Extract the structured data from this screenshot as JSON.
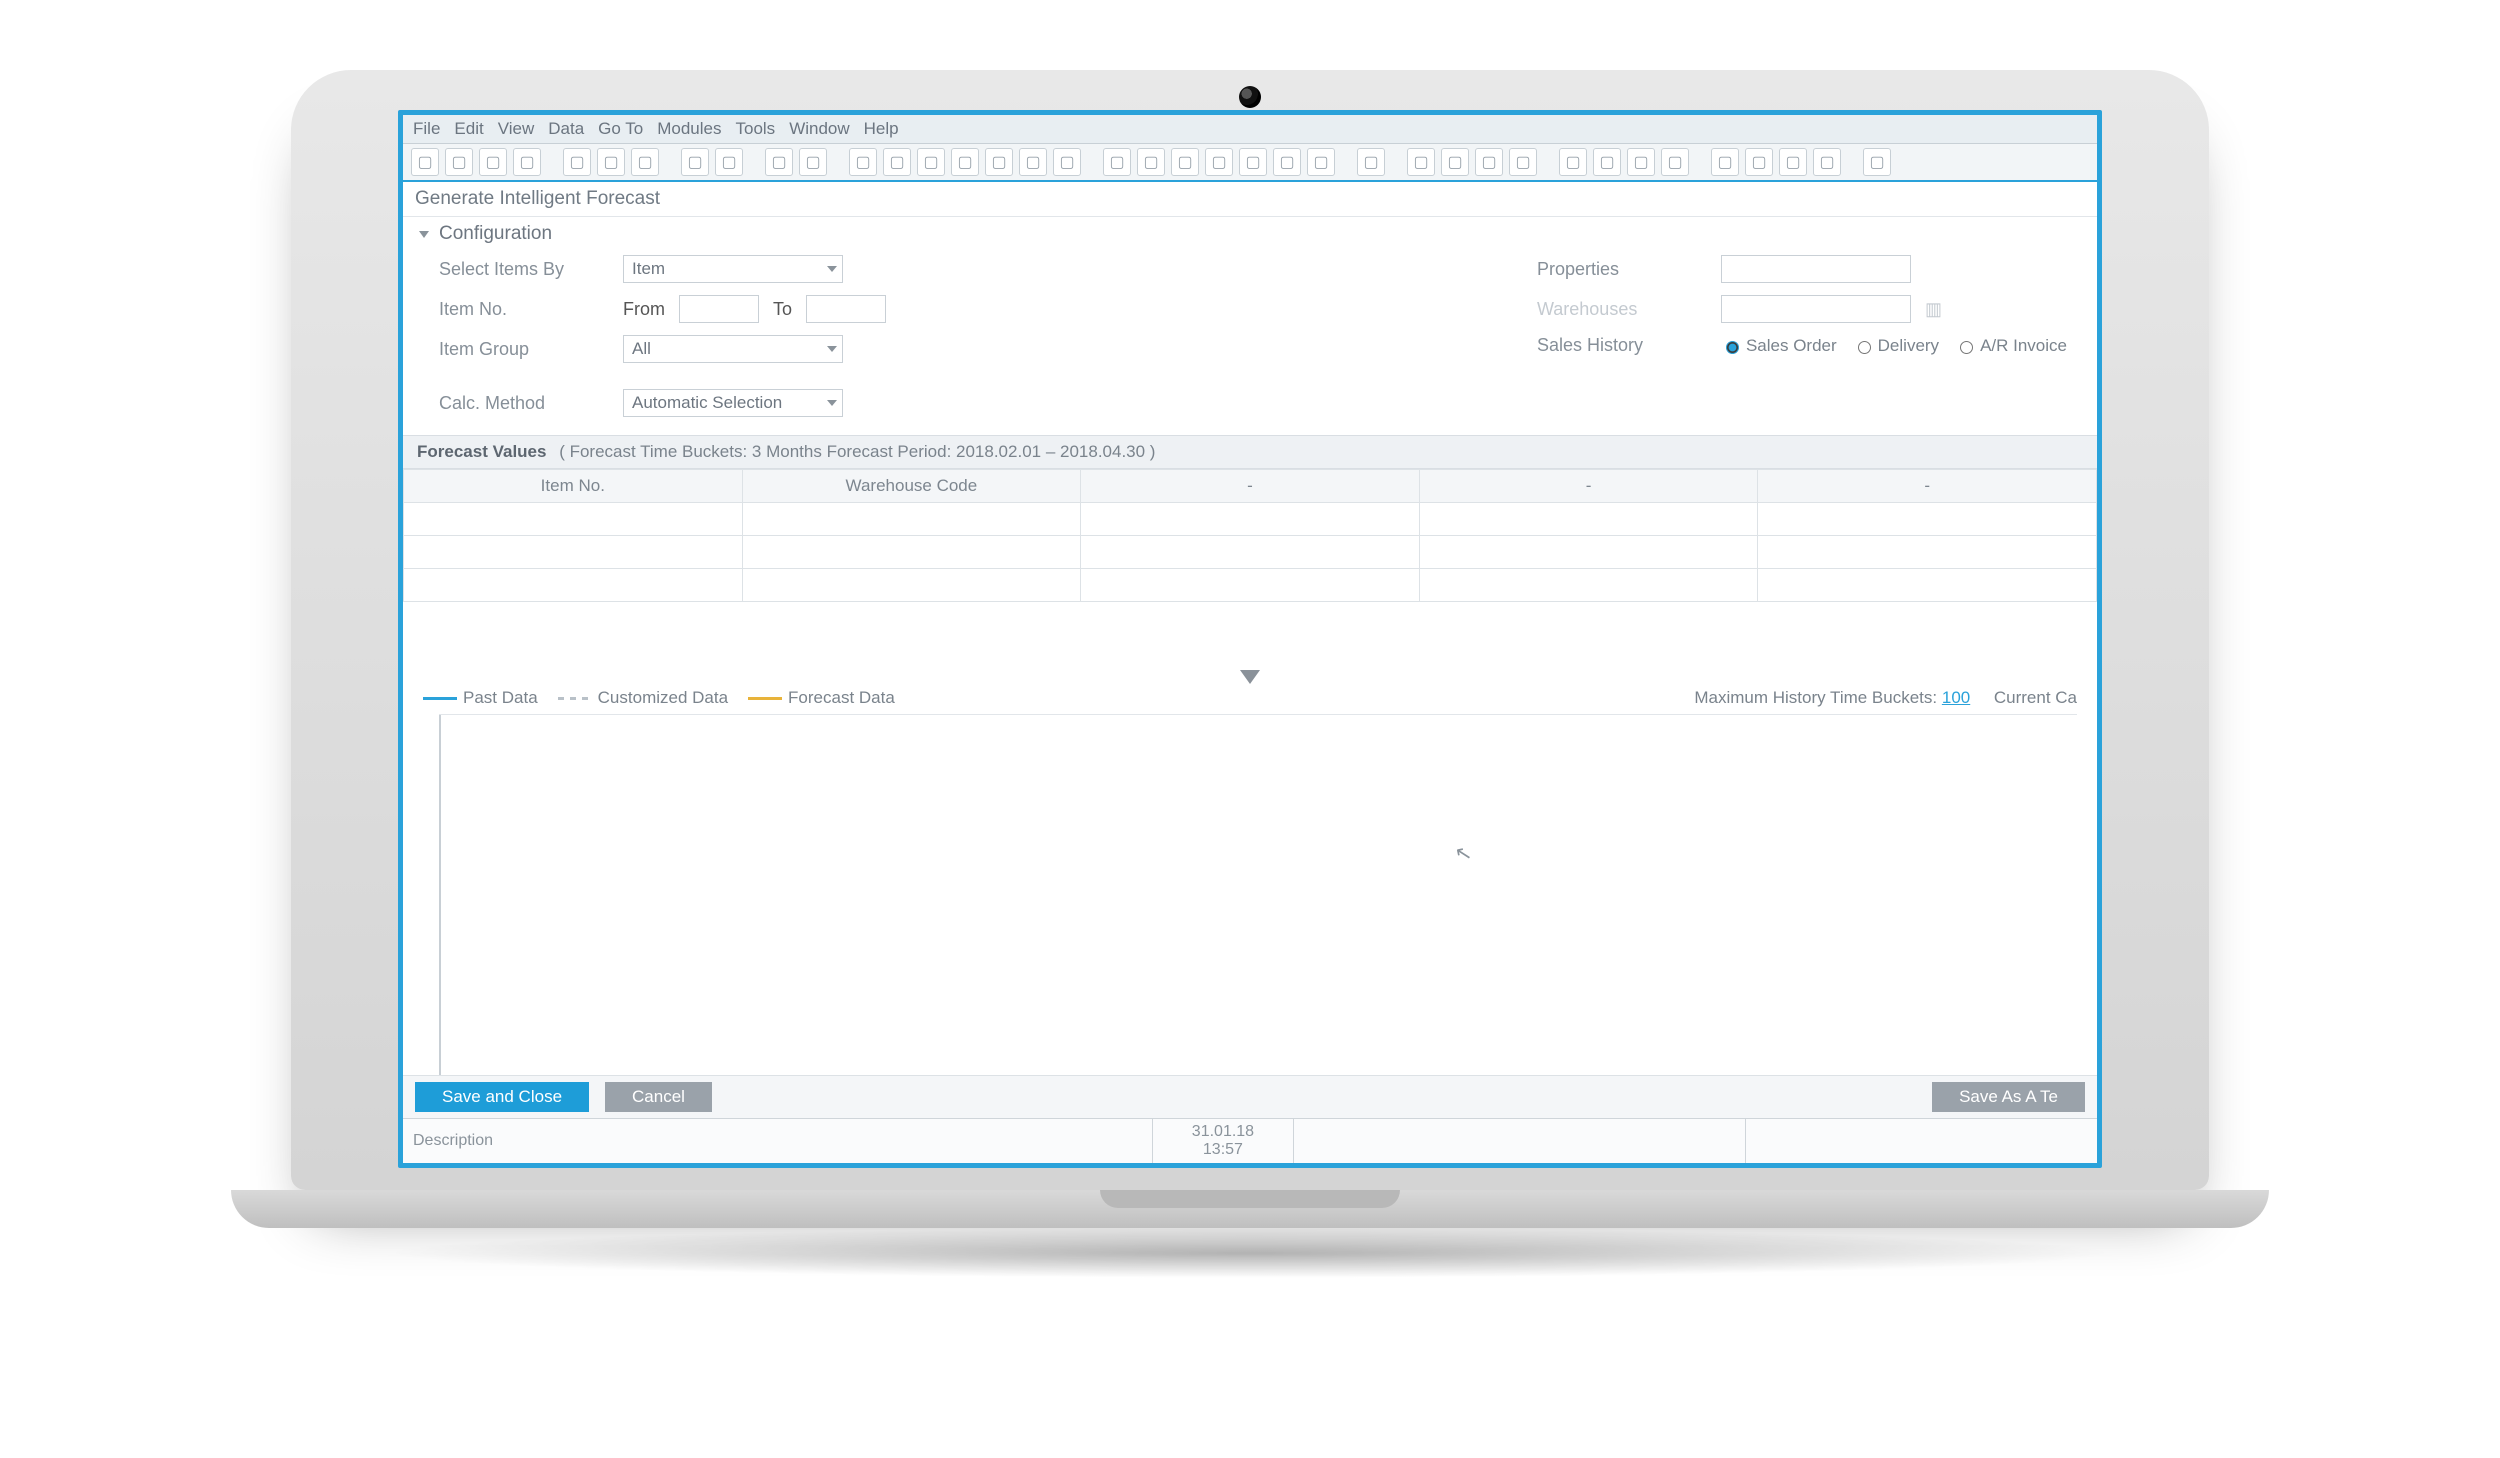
{
  "menubar": [
    "File",
    "Edit",
    "View",
    "Data",
    "Go To",
    "Modules",
    "Tools",
    "Window",
    "Help"
  ],
  "toolbar_icons": [
    "new-icon",
    "open-icon",
    "print-preview-icon",
    "close-window-icon",
    "sep",
    "preview-icon",
    "print-icon",
    "export-icon",
    "sep",
    "fit-icon",
    "layout-icon",
    "sep",
    "lock-icon",
    "calendar-icon",
    "sep",
    "first-record-icon",
    "prev-record-icon",
    "next-record-icon",
    "last-record-icon",
    "refresh-icon",
    "filter-icon",
    "sort-icon",
    "sep",
    "cut-icon",
    "copy-icon",
    "paste-icon",
    "find-icon",
    "undo-icon",
    "redo-icon",
    "attach-icon",
    "sep",
    "link-icon",
    "sep",
    "form-settings-icon",
    "user-defined-icon",
    "message-icon",
    "alert-icon",
    "sep",
    "relationship-icon",
    "workflow-icon",
    "query-icon",
    "user-icon",
    "sep",
    "customize-icon",
    "tools-icon",
    "window-list-icon",
    "arrow-out-icon",
    "sep",
    "help-icon"
  ],
  "page_title": "Generate Intelligent Forecast",
  "section_title": "Configuration",
  "form": {
    "select_items_by": {
      "label": "Select Items By",
      "value": "Item"
    },
    "item_no": {
      "label": "Item No.",
      "from_label": "From",
      "to_label": "To",
      "from": "",
      "to": ""
    },
    "item_group": {
      "label": "Item Group",
      "value": "All"
    },
    "calc_method": {
      "label": "Calc. Method",
      "value": "Automatic Selection"
    },
    "properties": {
      "label": "Properties",
      "value": ""
    },
    "warehouses": {
      "label": "Warehouses",
      "value": "",
      "disabled": true
    },
    "sales_history": {
      "label": "Sales History",
      "options": [
        "Sales Order",
        "Delivery",
        "A/R Invoice"
      ],
      "selected": "Sales Order"
    }
  },
  "band": {
    "title": "Forecast Values",
    "meta": "( Forecast Time Buckets: 3 Months      Forecast Period: 2018.02.01 – 2018.04.30 )"
  },
  "grid": {
    "columns": [
      "Item No.",
      "Warehouse Code",
      "-",
      "-",
      "-"
    ],
    "rows": [
      [
        "",
        "",
        "",
        "",
        ""
      ],
      [
        "",
        "",
        "",
        "",
        ""
      ],
      [
        "",
        "",
        "",
        "",
        ""
      ]
    ]
  },
  "legend": {
    "past": "Past Data",
    "custom": "Customized Data",
    "forecast": "Forecast Data",
    "max_history": {
      "label": "Maximum History Time Buckets:",
      "value": "100"
    },
    "current": "Current Ca"
  },
  "footer": {
    "save": "Save and Close",
    "cancel": "Cancel",
    "save_tpl": "Save As A Te"
  },
  "status": {
    "desc_label": "Description",
    "date": "31.01.18",
    "time": "13:57"
  }
}
